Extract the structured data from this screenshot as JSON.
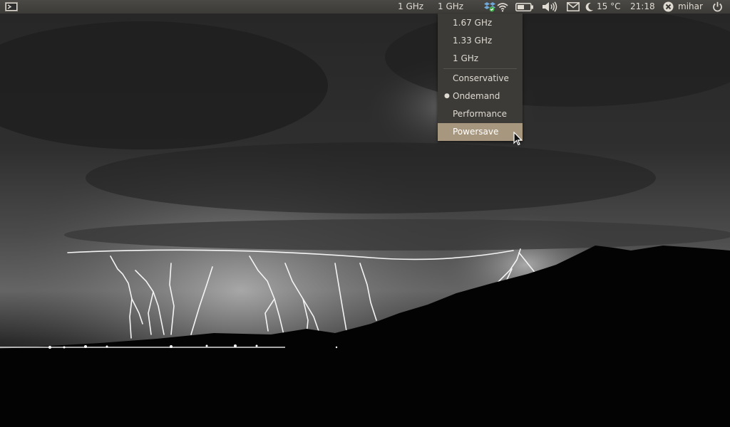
{
  "panel": {
    "cpu_freq_1": "1 GHz",
    "cpu_freq_2": "1 GHz",
    "weather_temp": "15 °C",
    "clock": "21:18",
    "user": "mihar",
    "icons": [
      "terminal-icon",
      "dropbox-icon",
      "wifi-icon",
      "battery-icon",
      "volume-icon",
      "mail-icon",
      "moon-icon",
      "user-status-icon",
      "power-icon"
    ]
  },
  "freq_menu": {
    "frequencies": [
      "1.67 GHz",
      "1.33 GHz",
      "1 GHz"
    ],
    "governors": [
      {
        "label": "Conservative",
        "selected": false
      },
      {
        "label": "Ondemand",
        "selected": true
      },
      {
        "label": "Performance",
        "selected": false
      },
      {
        "label": "Powersave",
        "selected": false,
        "highlighted": true
      }
    ],
    "bullet": "●"
  },
  "colors": {
    "panel_bg": "#3c3b37",
    "panel_text": "#dfdbd2",
    "menu_highlight": "#a8977f"
  }
}
